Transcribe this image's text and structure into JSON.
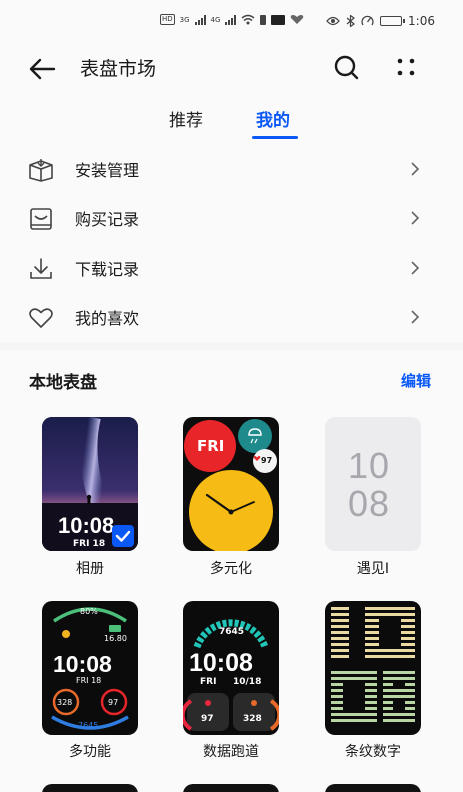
{
  "status_bar": {
    "left_icons": [
      "hd-icon",
      "signal-4g-icon",
      "signal-icon",
      "wifi-icon",
      "sim-icon",
      "app-notify-icon"
    ],
    "hd": "HD",
    "net1": "3G",
    "net2": "4G",
    "right_icons": [
      "eye-icon",
      "bluetooth-icon",
      "speed-icon",
      "battery-icon"
    ],
    "time": "1:06"
  },
  "header": {
    "title": "表盘市场",
    "back_icon": "back-arrow-icon",
    "search_icon": "search-icon",
    "more_icon": "more-dots-icon"
  },
  "tabs": [
    {
      "label": "推荐",
      "active": false
    },
    {
      "label": "我的",
      "active": true
    }
  ],
  "accent_color": "#0a59f7",
  "menu": [
    {
      "label": "安装管理",
      "icon": "install-box-icon"
    },
    {
      "label": "购买记录",
      "icon": "purchase-icon"
    },
    {
      "label": "下载记录",
      "icon": "download-icon"
    },
    {
      "label": "我的喜欢",
      "icon": "heart-icon"
    }
  ],
  "local_faces": {
    "title": "本地表盘",
    "edit_label": "编辑",
    "items": [
      {
        "name": "相册",
        "time": "10:08",
        "date": "FRI 18",
        "selected": true
      },
      {
        "name": "多元化",
        "day": "FRI",
        "heart": "97"
      },
      {
        "name": "遇见I",
        "hour": "10",
        "minute": "08"
      },
      {
        "name": "多功能",
        "battery": "80%",
        "time": "10:08",
        "date": "FRI 18",
        "left_val": "328",
        "right_val": "97",
        "bottom_val": "7645",
        "side_val": "16.80"
      },
      {
        "name": "数据跑道",
        "steps": "7645",
        "time": "10:08",
        "day": "FRI",
        "date": "10/18",
        "left_val": "97",
        "right_val": "328"
      },
      {
        "name": "条纹数字"
      }
    ]
  }
}
